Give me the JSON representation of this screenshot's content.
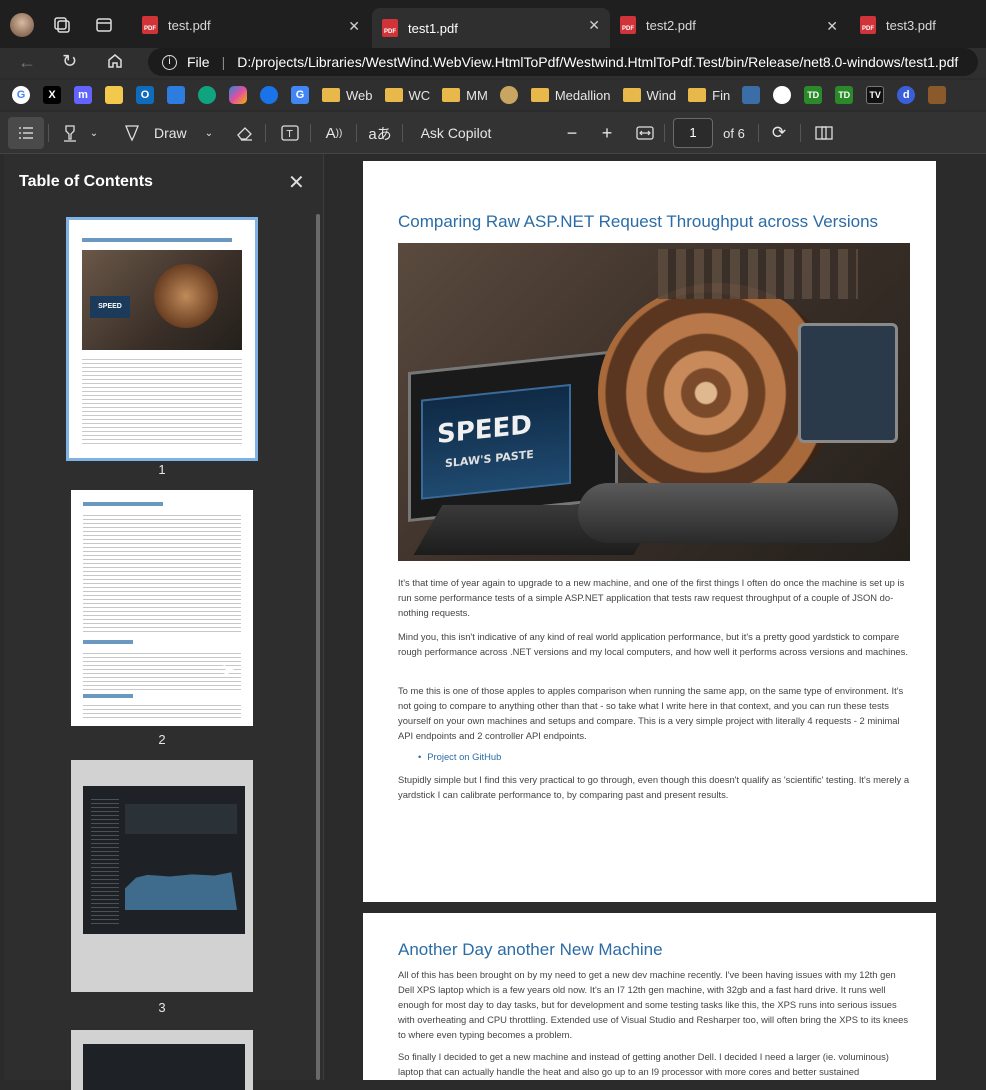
{
  "tabs": [
    {
      "label": "test.pdf"
    },
    {
      "label": "test1.pdf"
    },
    {
      "label": "test2.pdf"
    },
    {
      "label": "test3.pdf"
    }
  ],
  "address": {
    "scheme_label": "File",
    "path": "D:/projects/Libraries/WestWind.WebView.HtmlToPdf/Westwind.HtmlToPdf.Test/bin/Release/net8.0-windows/test1.pdf"
  },
  "bookmarks": {
    "folders": [
      "Web",
      "WC",
      "MM",
      "Medallion",
      "Wind",
      "Fin"
    ]
  },
  "pdf_toolbar": {
    "draw_label": "Draw",
    "copilot_label": "Ask Copilot",
    "page_number": "1",
    "page_count": "of 6"
  },
  "sidebar": {
    "title": "Table of Contents",
    "thumbnails": [
      {
        "number": "1"
      },
      {
        "number": "2"
      },
      {
        "number": "3"
      }
    ]
  },
  "document": {
    "page1": {
      "heading": "Comparing Raw ASP.NET Request Throughput across Versions",
      "image_text": {
        "screen_big": "SPEED",
        "screen_small": "SLAW'S PASTE"
      },
      "paragraphs": [
        "It's that time of year again to upgrade to a new machine, and one of the first things I often do once the machine is set up is run some performance tests of a simple ASP.NET application that tests raw request throughput of a couple of JSON do-nothing requests.",
        "Mind you, this isn't indicative of any kind of real world application performance, but it's a pretty good yardstick to compare rough performance across .NET versions and my local computers, and how well it performs across versions and machines.",
        "To me this is one of those apples to apples comparison when running the same app, on the same type of environment. It's not going to compare to anything other than that - so take what I write here in that context, and you can run these tests yourself on your own machines and setups and compare. This is a very simple project with literally 4 requests - 2 minimal API endpoints and 2 controller API endpoints."
      ],
      "link": "Project on GitHub",
      "closing": "Stupidly simple but I find this very practical to go through, even though this doesn't qualify as 'scientific' testing. It's merely a yardstick I can calibrate performance to, by comparing past and present results."
    },
    "page2": {
      "heading": "Another Day another New Machine",
      "paragraphs": [
        "All of this has been brought on by my need to get a new dev machine recently. I've been having issues with my 12th gen Dell XPS laptop which is a few years old now. It's an I7 12th gen machine, with 32gb and a fast hard drive. It runs well enough for most day to day tasks, but for development and some testing tasks like this, the XPS runs into serious issues with overheating and CPU throttling. Extended use of Visual Studio and Resharper too, will often bring the XPS to its knees to where even typing becomes a problem.",
        "So finally I decided to get a new machine and instead of getting another Dell. I decided I need a larger (ie. voluminous) laptop that can actually handle the heat and also go up to an I9 processor with more cores and better sustained"
      ]
    }
  },
  "colors": {
    "accent_link": "#2b6ca6",
    "pdf_red": "#d13438",
    "folder": "#e8b84a",
    "selected_thumb": "#7fb2e5"
  }
}
